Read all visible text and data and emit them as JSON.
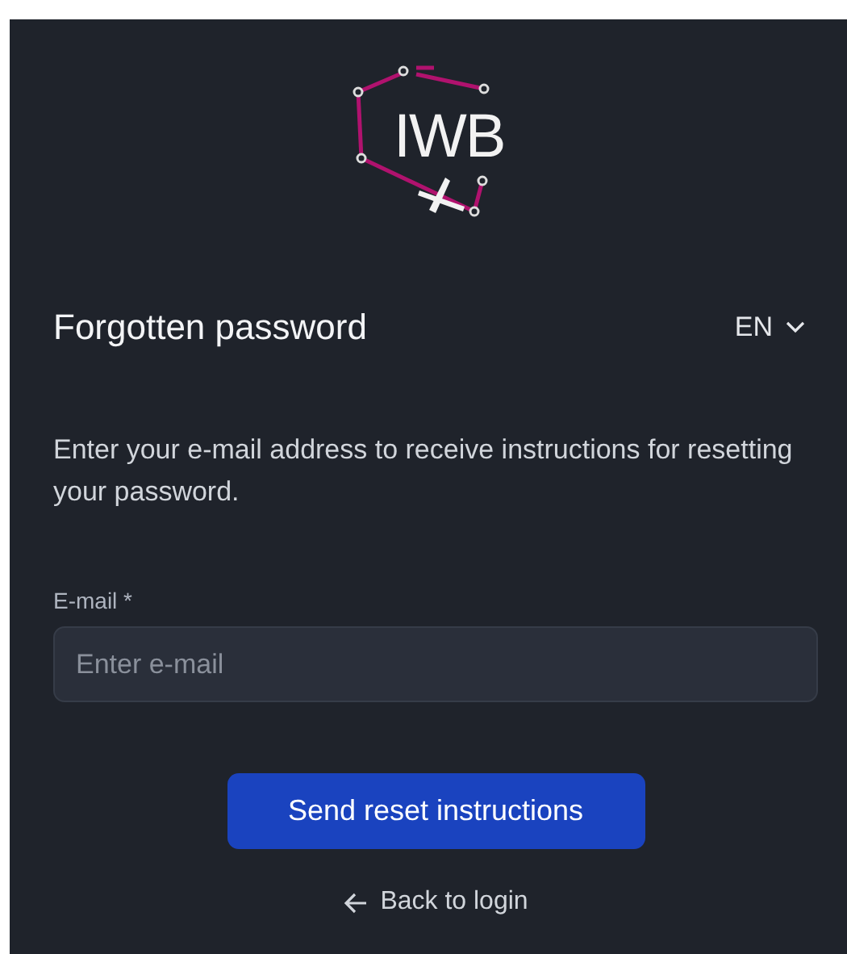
{
  "logo": {
    "text": "IWB"
  },
  "header": {
    "title": "Forgotten password",
    "language": "EN"
  },
  "description": "Enter your e-mail address to receive instructions for resetting your password.",
  "email": {
    "label": "E-mail *",
    "placeholder": "Enter e-mail"
  },
  "submit": "Send reset instructions",
  "back_link": "Back to login"
}
